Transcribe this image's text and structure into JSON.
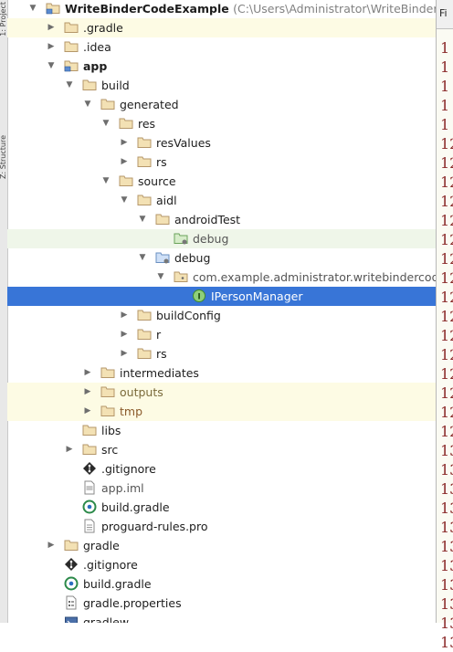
{
  "side_tabs": [
    "1: Project",
    "Z: Structure"
  ],
  "editor": {
    "tab_label": "Fi",
    "line_numbers": [
      "1",
      "1",
      "1",
      "1",
      "1",
      "12",
      "12",
      "12",
      "12",
      "12",
      "12",
      "12",
      "12",
      "12",
      "12",
      "12",
      "12",
      "12",
      "12",
      "12",
      "12",
      "13",
      "13",
      "13",
      "13",
      "13",
      "13",
      "13",
      "13",
      "13",
      "13",
      "13"
    ]
  },
  "tree": {
    "rows": [
      {
        "label": "WriteBinderCodeExample",
        "path": "(C:\\Users\\Administrator\\WriteBinderCodeExample)",
        "arrow": "▼",
        "icon": "module-folder-icon"
      },
      {
        "label": ".gradle",
        "arrow": "▶",
        "icon": "folder-icon"
      },
      {
        "label": ".idea",
        "arrow": "▶",
        "icon": "folder-icon"
      },
      {
        "label": "app",
        "arrow": "▼",
        "icon": "module-folder-icon"
      },
      {
        "label": "build",
        "arrow": "▼",
        "icon": "folder-icon"
      },
      {
        "label": "generated",
        "arrow": "▼",
        "icon": "folder-icon"
      },
      {
        "label": "res",
        "arrow": "▼",
        "icon": "folder-icon"
      },
      {
        "label": "resValues",
        "arrow": "▶",
        "icon": "folder-icon"
      },
      {
        "label": "rs",
        "arrow": "▶",
        "icon": "folder-icon"
      },
      {
        "label": "source",
        "arrow": "▼",
        "icon": "folder-icon"
      },
      {
        "label": "aidl",
        "arrow": "▼",
        "icon": "folder-icon"
      },
      {
        "label": "androidTest",
        "arrow": "▼",
        "icon": "folder-icon"
      },
      {
        "label": "debug",
        "arrow": "",
        "icon": "test-source-folder-icon"
      },
      {
        "label": "debug",
        "arrow": "▼",
        "icon": "source-folder-icon"
      },
      {
        "label": "com.example.administrator.writebindercodeexample",
        "arrow": "▼",
        "icon": "package-icon"
      },
      {
        "label": "IPersonManager",
        "arrow": "",
        "icon": "interface-icon"
      },
      {
        "label": "buildConfig",
        "arrow": "▶",
        "icon": "folder-icon"
      },
      {
        "label": "r",
        "arrow": "▶",
        "icon": "folder-icon"
      },
      {
        "label": "rs",
        "arrow": "▶",
        "icon": "folder-icon"
      },
      {
        "label": "intermediates",
        "arrow": "▶",
        "icon": "folder-icon"
      },
      {
        "label": "outputs",
        "arrow": "▶",
        "icon": "folder-icon"
      },
      {
        "label": "tmp",
        "arrow": "▶",
        "icon": "folder-icon"
      },
      {
        "label": "libs",
        "arrow": "",
        "icon": "folder-icon"
      },
      {
        "label": "src",
        "arrow": "▶",
        "icon": "folder-icon"
      },
      {
        "label": ".gitignore",
        "arrow": "",
        "icon": "git-icon"
      },
      {
        "label": "app.iml",
        "arrow": "",
        "icon": "iml-file-icon"
      },
      {
        "label": "build.gradle",
        "arrow": "",
        "icon": "gradle-icon"
      },
      {
        "label": "proguard-rules.pro",
        "arrow": "",
        "icon": "text-file-icon"
      },
      {
        "label": "gradle",
        "arrow": "▶",
        "icon": "folder-icon"
      },
      {
        "label": ".gitignore",
        "arrow": "",
        "icon": "git-icon"
      },
      {
        "label": "build.gradle",
        "arrow": "",
        "icon": "gradle-icon"
      },
      {
        "label": "gradle.properties",
        "arrow": "",
        "icon": "properties-file-icon"
      },
      {
        "label": "gradlew",
        "arrow": "",
        "icon": "script-file-icon"
      }
    ]
  }
}
